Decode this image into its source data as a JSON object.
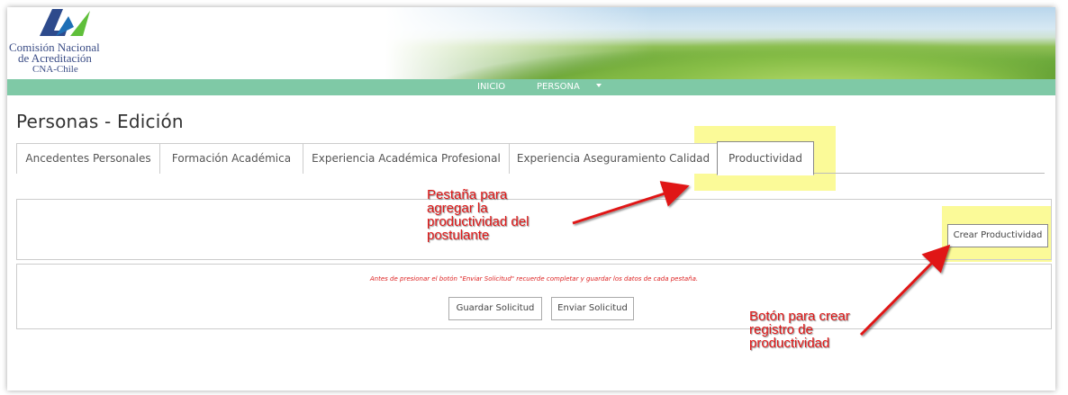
{
  "header": {
    "logo_line1": "Comisión Nacional",
    "logo_line2": "de Acreditación",
    "logo_line3": "CNA-Chile"
  },
  "nav": {
    "items": [
      {
        "label": "INICIO"
      },
      {
        "label": "PERSONA"
      }
    ]
  },
  "page_title": "Personas - Edición",
  "tabs": [
    {
      "label": "Ancedentes Personales",
      "active": false
    },
    {
      "label": "Formación Académica",
      "active": false
    },
    {
      "label": "Experiencia Académica Profesional",
      "active": false
    },
    {
      "label": "Experiencia Aseguramiento Calidad",
      "active": false
    },
    {
      "label": "Productividad",
      "active": true
    }
  ],
  "productividad": {
    "create_button": "Crear Productividad"
  },
  "footer_box": {
    "warning": "Antes de presionar el botón \"Enviar Solicitud\" recuerde completar y guardar los datos de cada pestaña.",
    "save_button": "Guardar Solicitud",
    "send_button": "Enviar Solicitud"
  },
  "annotations": {
    "tab_note": [
      "Pestaña para",
      "agregar la",
      "productividad del",
      "postulante"
    ],
    "button_note": [
      "Botón para crear",
      "registro de",
      "productividad"
    ]
  },
  "colors": {
    "navbar": "#7fc9a6",
    "highlight": "#fbf98d",
    "annotation": "#e01818",
    "logo_text": "#3b4d86"
  }
}
